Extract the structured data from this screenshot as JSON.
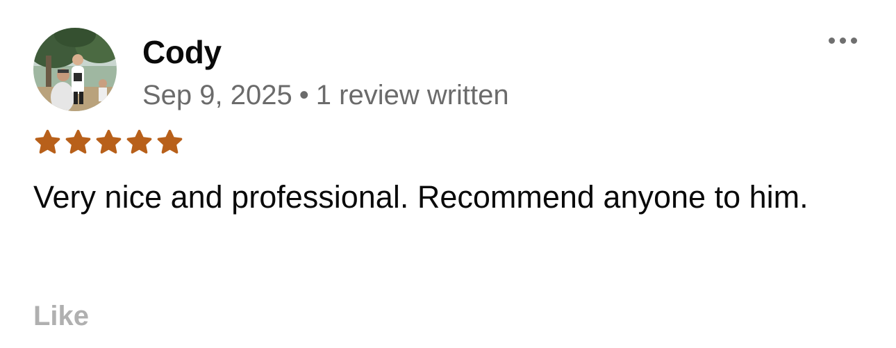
{
  "review": {
    "author_name": "Cody",
    "date": "Sep 9, 2025",
    "separator": "•",
    "review_count": "1 review written",
    "rating": 5,
    "rating_max": 5,
    "star_color": "#b8601a",
    "text": "Very nice and professional. Recommend anyone to him.",
    "like_label": "Like"
  },
  "icons": {
    "avatar": "profile-photo",
    "more": "more-options-icon",
    "star": "star-icon"
  }
}
